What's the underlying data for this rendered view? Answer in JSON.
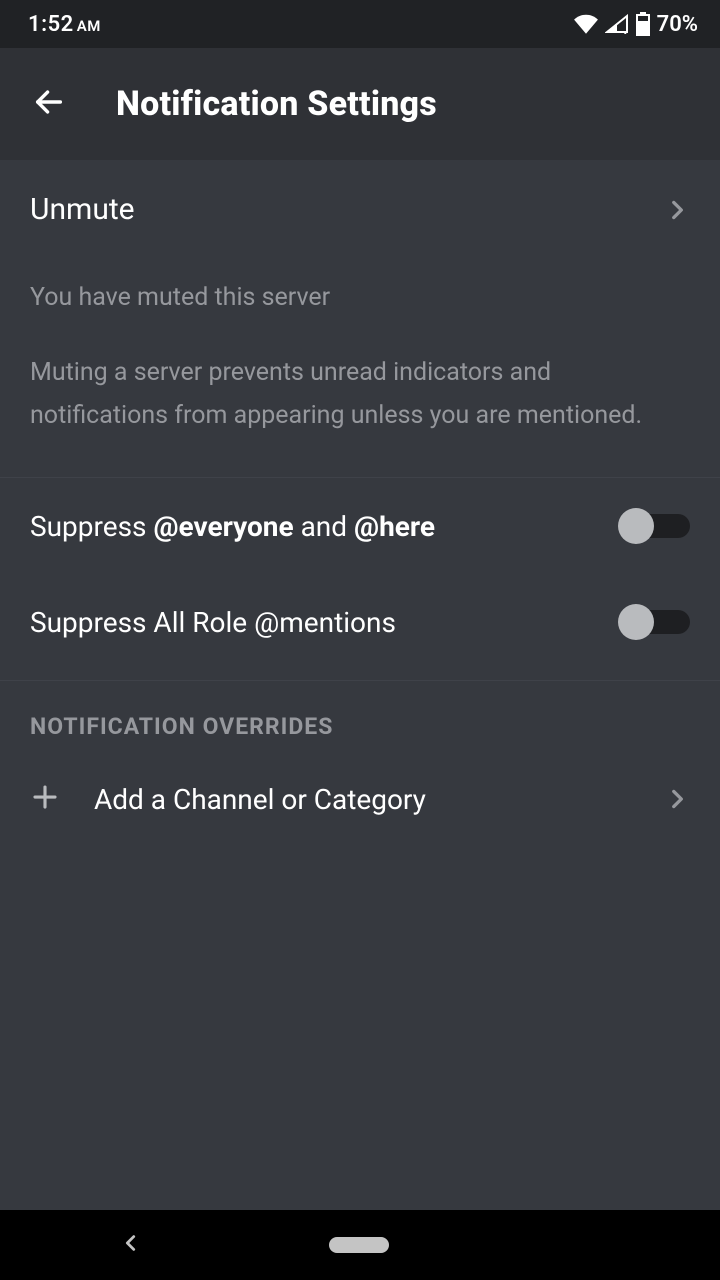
{
  "status": {
    "time": "1:52",
    "ampm": "AM",
    "battery_pct": "70%"
  },
  "header": {
    "title": "Notification Settings"
  },
  "unmute": {
    "label": "Unmute",
    "sub1": "You have muted this server",
    "sub2": "Muting a server prevents unread indicators and notifications from appearing unless you are mentioned."
  },
  "suppress1": {
    "prefix": "Suppress ",
    "bold1": "@everyone",
    "mid": " and ",
    "bold2": "@here",
    "value": false
  },
  "suppress2": {
    "label": "Suppress All Role @mentions",
    "value": false
  },
  "overrides": {
    "header": "NOTIFICATION OVERRIDES",
    "add_label": "Add a Channel or Category"
  }
}
